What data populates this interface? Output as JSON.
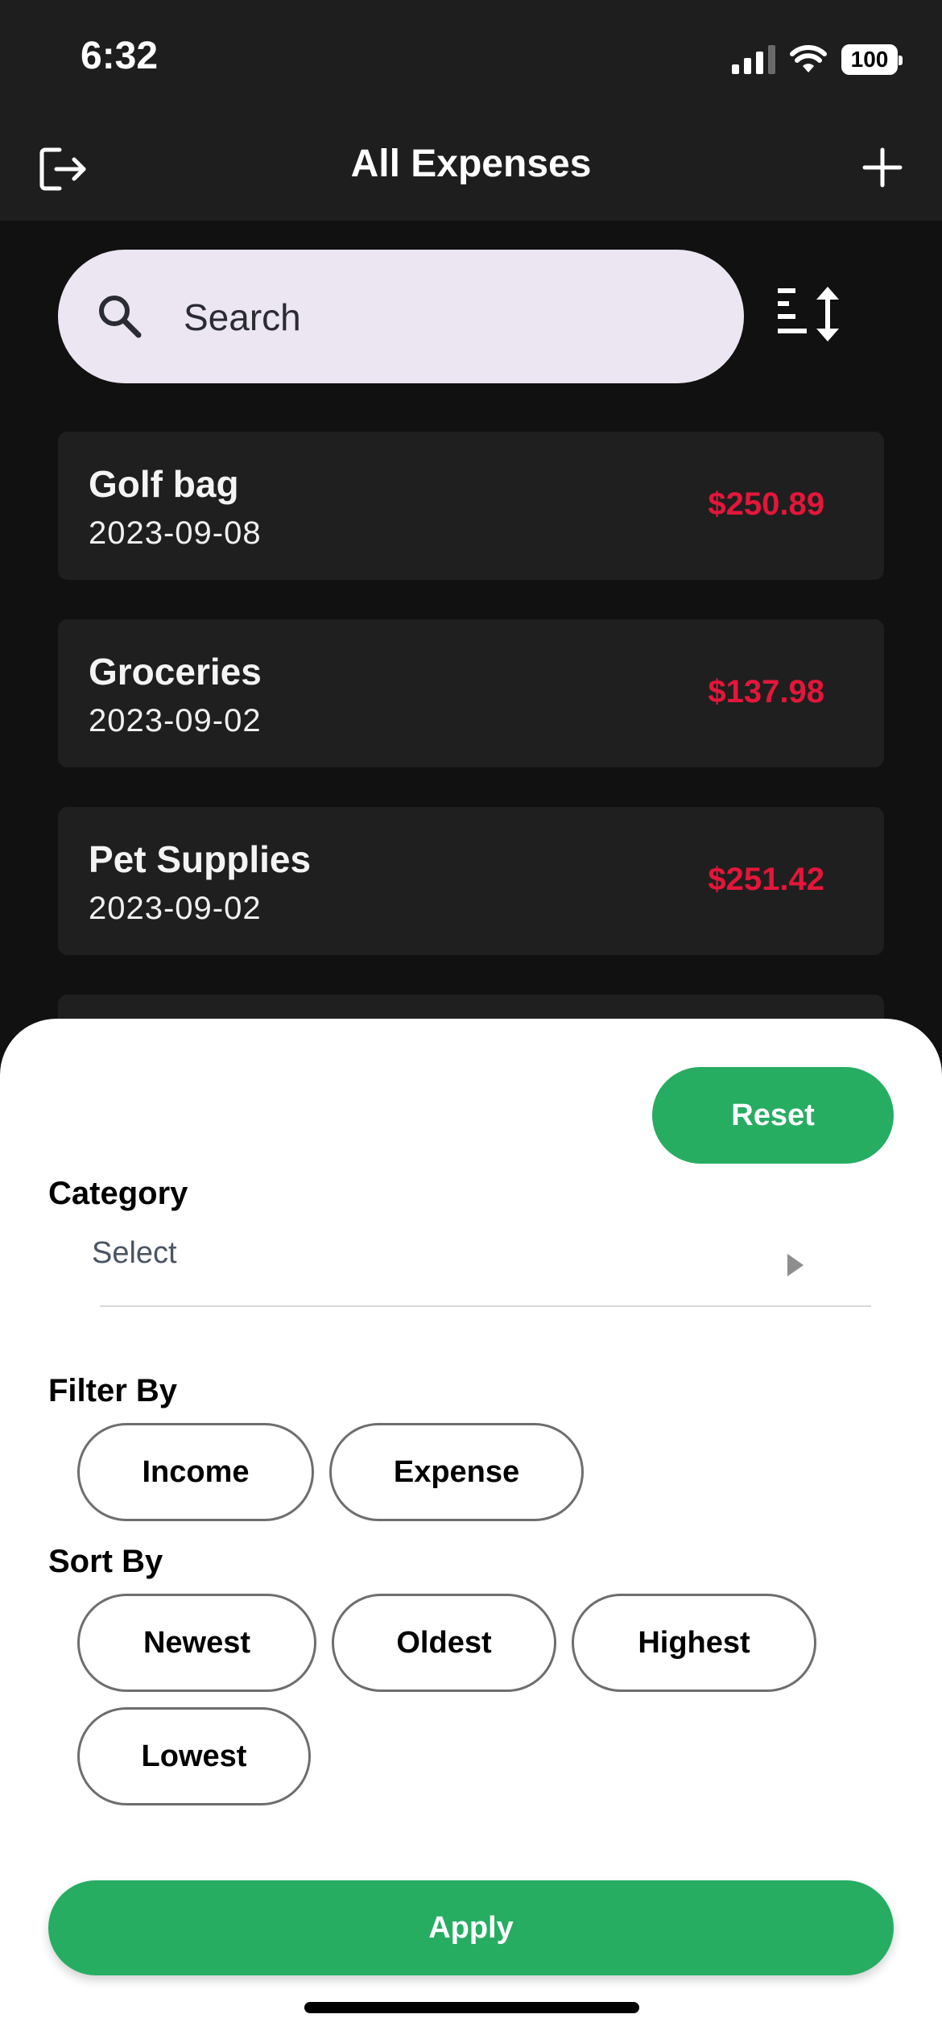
{
  "status_bar": {
    "time": "6:32",
    "battery": "100"
  },
  "nav": {
    "title": "All Expenses",
    "left_icon": "logout-icon",
    "right_icon": "plus-icon"
  },
  "search": {
    "placeholder": "Search",
    "icon": "search-icon",
    "sort_icon": "sort-icon"
  },
  "expenses": [
    {
      "title": "Golf bag",
      "date": "2023-09-08",
      "amount": "$250.89"
    },
    {
      "title": "Groceries",
      "date": "2023-09-02",
      "amount": "$137.98"
    },
    {
      "title": "Pet Supplies",
      "date": "2023-09-02",
      "amount": "$251.42"
    }
  ],
  "filter_sheet": {
    "reset_label": "Reset",
    "category_label": "Category",
    "category_value": "Select",
    "filter_by_label": "Filter By",
    "filter_by_options": [
      "Income",
      "Expense"
    ],
    "sort_by_label": "Sort By",
    "sort_by_options": [
      "Newest",
      "Oldest",
      "Highest",
      "Lowest"
    ],
    "apply_label": "Apply"
  },
  "colors": {
    "accent_green": "#26ad62",
    "amount_red": "#e4163a",
    "search_bg": "#ece6f2",
    "card_bg": "#1f1f1f"
  }
}
